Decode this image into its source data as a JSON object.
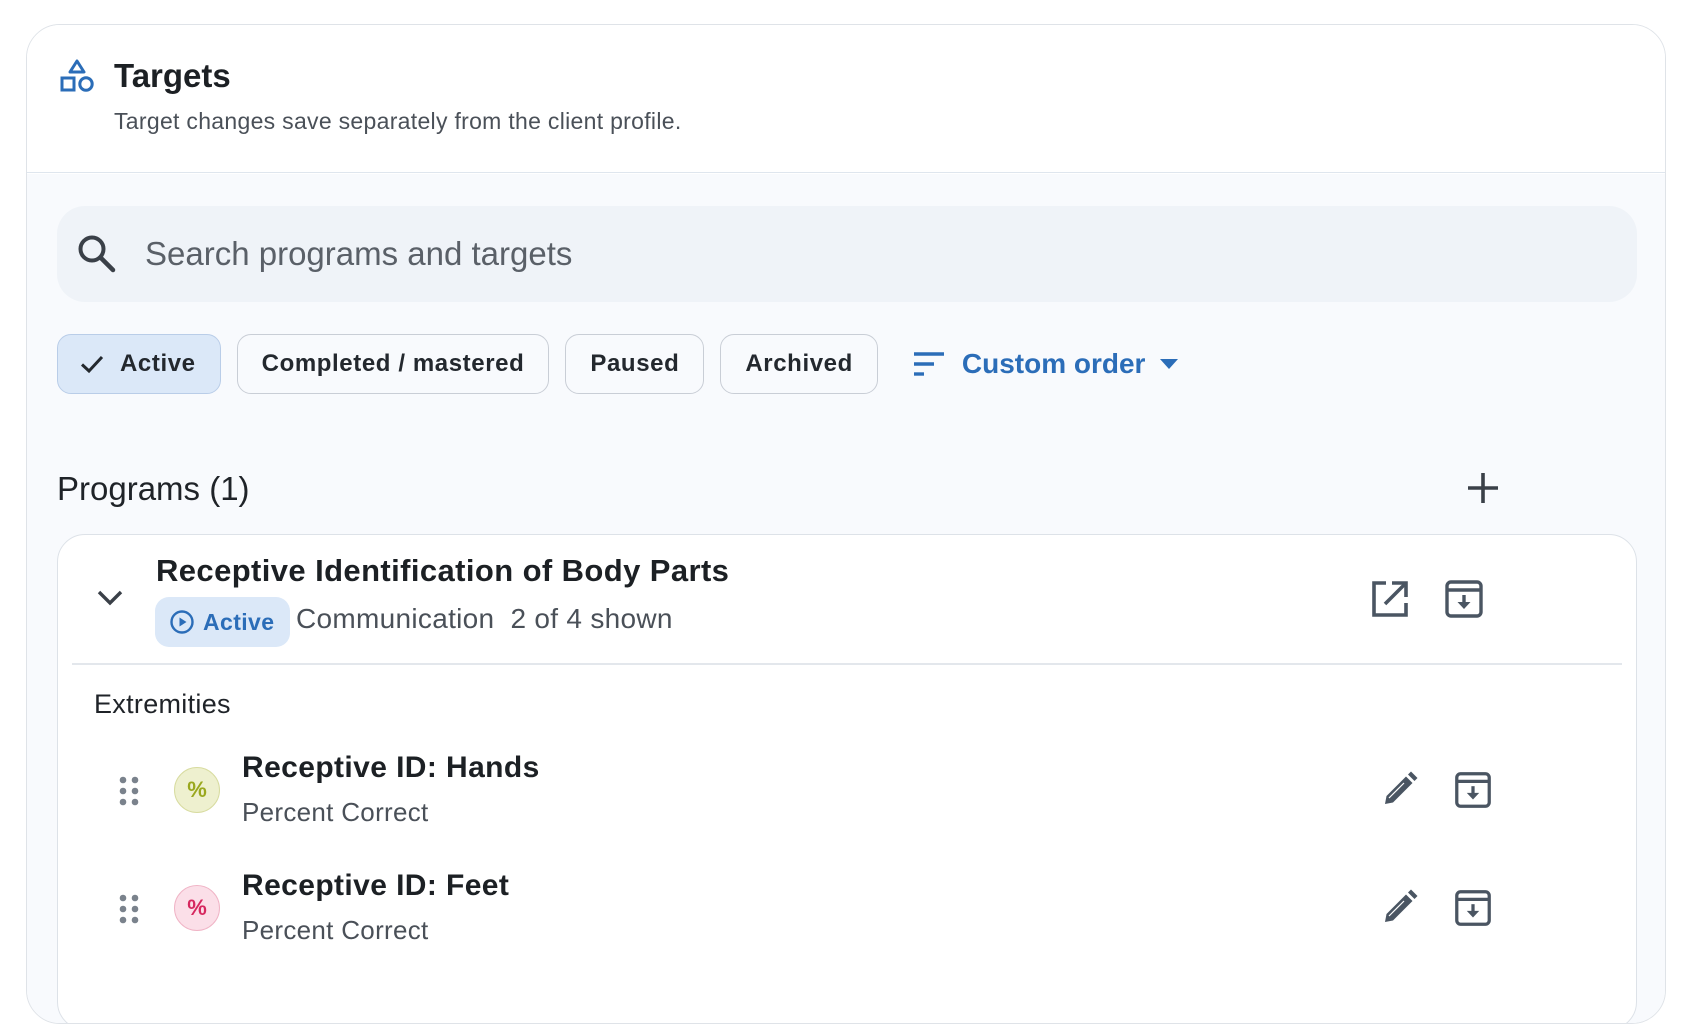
{
  "header": {
    "title": "Targets",
    "subtitle": "Target changes save separately from the client profile."
  },
  "search": {
    "placeholder": "Search programs and targets",
    "value": ""
  },
  "filters": [
    {
      "label": "Active",
      "selected": true
    },
    {
      "label": "Completed / mastered",
      "selected": false
    },
    {
      "label": "Paused",
      "selected": false
    },
    {
      "label": "Archived",
      "selected": false
    }
  ],
  "sort": {
    "label": "Custom order"
  },
  "programs": {
    "heading": "Programs (1)",
    "items": [
      {
        "name": "Receptive Identification of Body Parts",
        "status": "Active",
        "domain": "Communication",
        "shown": "2 of 4 shown",
        "groups": [
          {
            "label": "Extremities",
            "targets": [
              {
                "name": "Receptive ID: Hands",
                "measure": "Percent Correct",
                "icon_symbol": "%",
                "icon_color": "#9aa81e",
                "icon_bg": "#eef0cf"
              },
              {
                "name": "Receptive ID: Feet",
                "measure": "Percent Correct",
                "icon_symbol": "%",
                "icon_color": "#d6285f",
                "icon_bg": "#fbdfe8"
              }
            ]
          }
        ]
      }
    ]
  },
  "colors": {
    "accent": "#2b6db8",
    "chip_selected_bg": "#dbe8f8",
    "icon_gray": "#4a5562"
  },
  "icons": {
    "header": "shapes-icon",
    "search": "search-icon",
    "check": "check-icon",
    "sort": "sort-lines-icon",
    "dropdown": "caret-down-icon",
    "add": "plus-icon",
    "expand": "chevron-down-icon",
    "status": "play-circle-icon",
    "open": "open-external-icon",
    "archive": "archive-icon",
    "drag": "drag-handle-icon",
    "edit": "pencil-icon"
  }
}
